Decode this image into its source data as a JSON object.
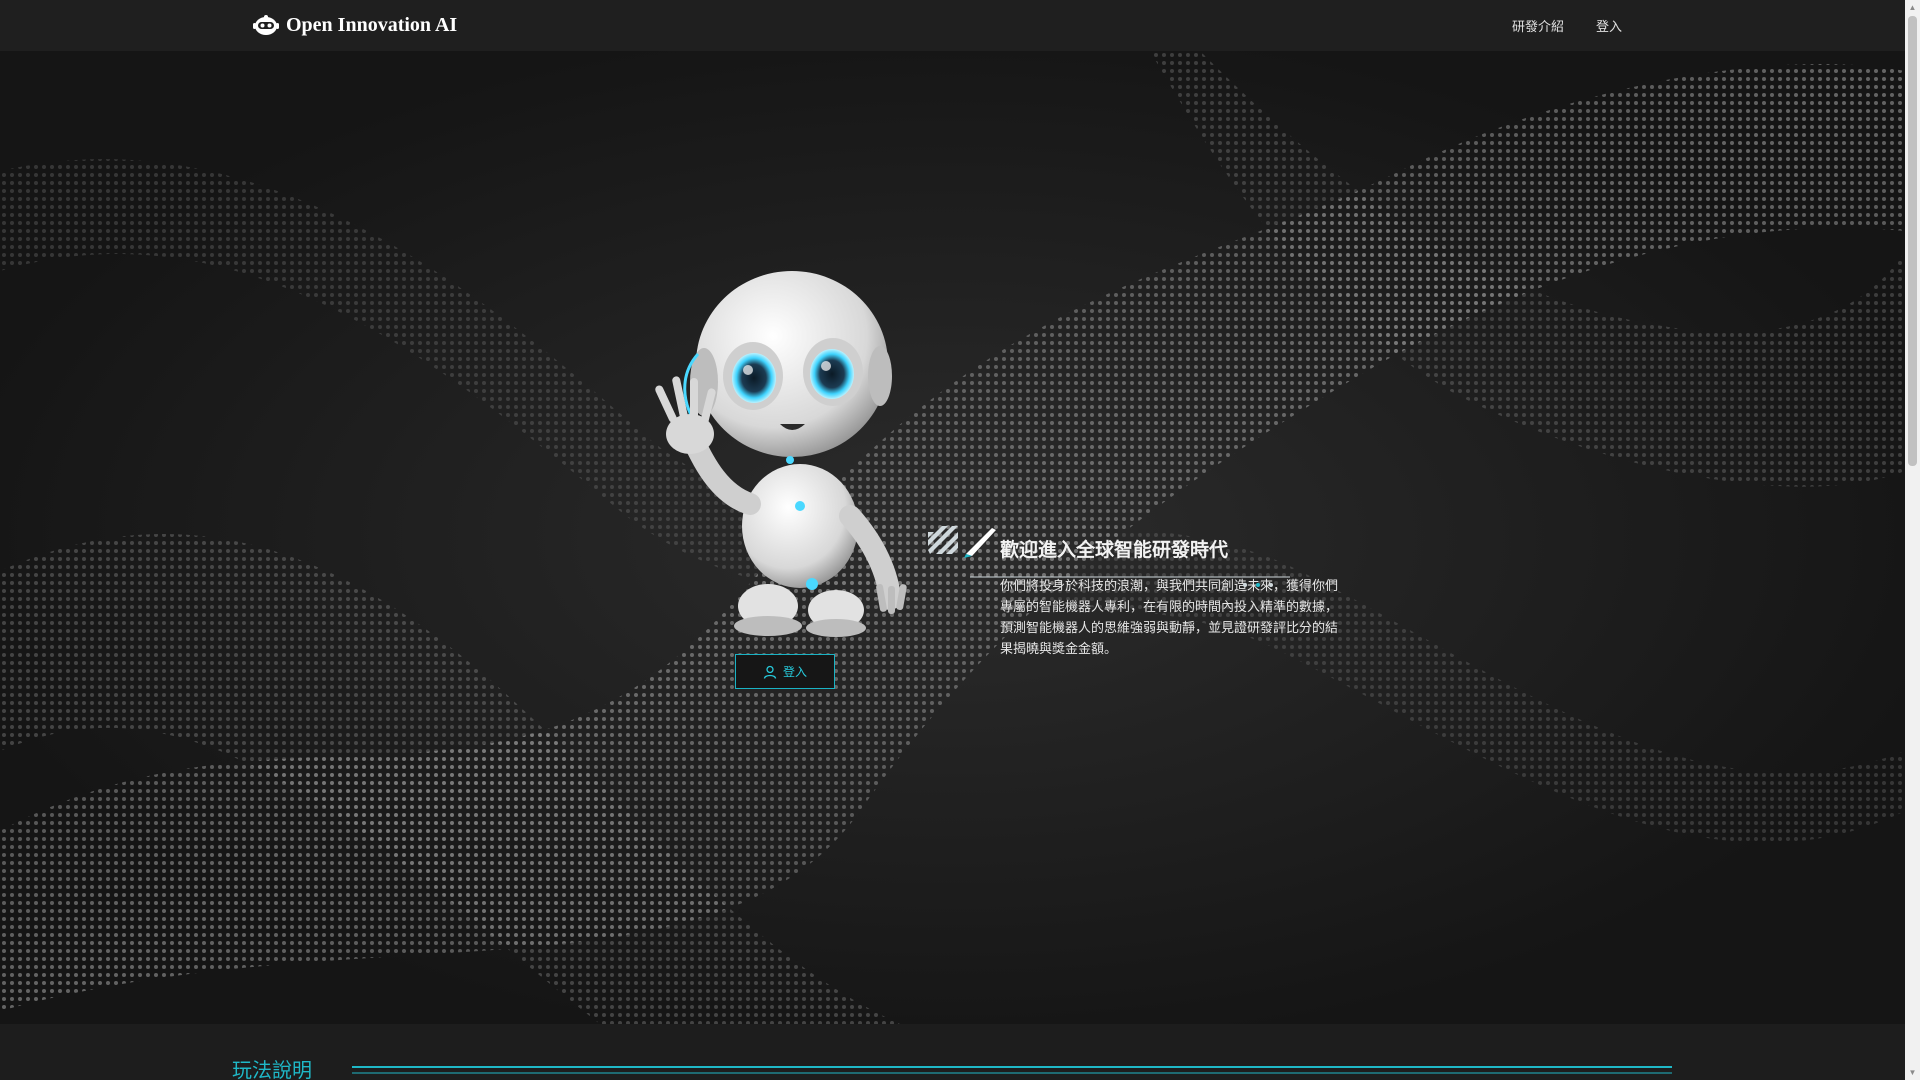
{
  "nav": {
    "brand": "Open Innovation AI",
    "links": [
      "研發介紹",
      "登入"
    ]
  },
  "hero": {
    "login_label": "登入",
    "title": "歡迎進入全球智能研發時代",
    "description": "你們將投身於科技的浪潮，與我們共同創造未來，獲得你們專屬的智能機器人專利，在有限的時間內投入精準的數據，預測智能機器人的思維強弱與動靜，並見證研發評比分的結果揭曉與獎金金額。"
  },
  "section": {
    "title": "玩法說明"
  },
  "colors": {
    "accent": "#1fb8c7",
    "background": "#1d1d1d",
    "navbar": "#1f1f1f"
  }
}
